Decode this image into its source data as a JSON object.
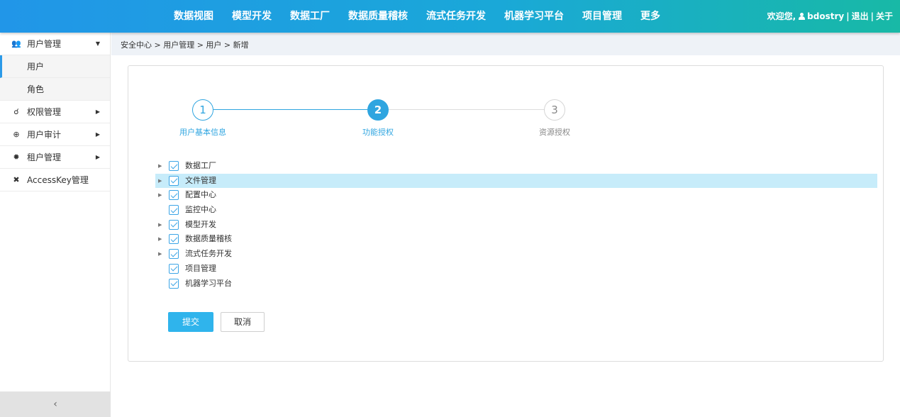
{
  "topnav": {
    "items": [
      "数据视图",
      "模型开发",
      "数据工厂",
      "数据质量稽核",
      "流式任务开发",
      "机器学习平台",
      "项目管理",
      "更多"
    ],
    "welcome": "欢迎您,",
    "username": "bdostry",
    "separator": "|",
    "logout": "退出",
    "about": "关于"
  },
  "sidebar": {
    "groups": [
      {
        "label": "用户管理",
        "icon": "users-icon",
        "expanded": true
      },
      {
        "label": "权限管理",
        "icon": "key-icon"
      },
      {
        "label": "用户审计",
        "icon": "search-plus-icon"
      },
      {
        "label": "租户管理",
        "icon": "gear-icon"
      },
      {
        "label": "AccessKey管理",
        "icon": "pin-icon"
      }
    ],
    "subitems": [
      "用户",
      "角色"
    ],
    "collapse_glyph": "‹"
  },
  "breadcrumb": "安全中心 > 用户管理 > 用户 > 新增",
  "steps": [
    {
      "number": "1",
      "label": "用户基本信息",
      "state": "done"
    },
    {
      "number": "2",
      "label": "功能授权",
      "state": "active"
    },
    {
      "number": "3",
      "label": "资源授权",
      "state": "todo"
    }
  ],
  "tree": [
    {
      "label": "数据工厂",
      "has_children": true,
      "checked": true
    },
    {
      "label": "文件管理",
      "has_children": true,
      "checked": true,
      "selected": true
    },
    {
      "label": "配置中心",
      "has_children": true,
      "checked": true
    },
    {
      "label": "监控中心",
      "has_children": false,
      "checked": true
    },
    {
      "label": "模型开发",
      "has_children": true,
      "checked": true
    },
    {
      "label": "数据质量稽核",
      "has_children": true,
      "checked": true
    },
    {
      "label": "流式任务开发",
      "has_children": true,
      "checked": true
    },
    {
      "label": "项目管理",
      "has_children": false,
      "checked": true
    },
    {
      "label": "机器学习平台",
      "has_children": false,
      "checked": true
    }
  ],
  "buttons": {
    "submit": "提交",
    "cancel": "取消"
  },
  "colors": {
    "accent": "#2fa5e0",
    "primary_button": "#2fb4ec",
    "selected_row": "#c7ecfa"
  }
}
